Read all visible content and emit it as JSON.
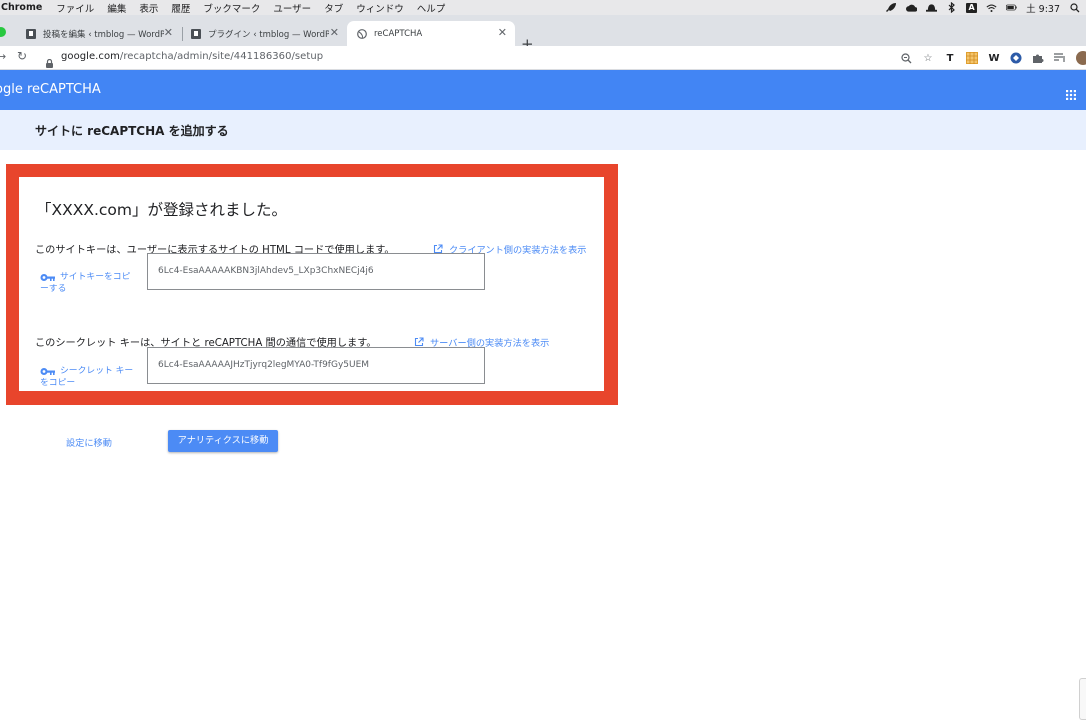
{
  "menubar": {
    "app": "Chrome",
    "items": [
      "ファイル",
      "編集",
      "表示",
      "履歴",
      "ブックマーク",
      "ユーザー",
      "タブ",
      "ウィンドウ",
      "ヘルプ"
    ],
    "input_indicator": "A",
    "clock": "土 9:37"
  },
  "tabs": [
    {
      "title": "投稿を編集 ‹ tmblog — WordPre"
    },
    {
      "title": "プラグイン ‹ tmblog — WordPre"
    },
    {
      "title": "reCAPTCHA"
    }
  ],
  "toolbar": {
    "url_host": "google.com",
    "url_path": "/recaptcha/admin/site/441186360/setup",
    "ext_t": "T",
    "ext_w": "W"
  },
  "header": {
    "logo": "ogle reCAPTCHA"
  },
  "page": {
    "title": "サイトに reCAPTCHA を追加する"
  },
  "card": {
    "registered": "「XXXX.com」が登録されました。",
    "site_key_desc": "このサイトキーは、ユーザーに表示するサイトの HTML コードで使用します。",
    "client_link": "クライアント側の実装方法を表示",
    "copy_site_key_1": "サイトキーをコピ",
    "copy_site_key_2": "ーする",
    "site_key": "6Lc4-EsaAAAAAKBN3jlAhdev5_LXp3ChxNECj4j6",
    "secret_desc": "このシークレット キーは、サイトと reCAPTCHA 間の通信で使用します。",
    "server_link": "サーバー側の実装方法を表示",
    "copy_secret_1": "シークレット キー",
    "copy_secret_2": "をコピー",
    "secret_key": "6Lc4-EsaAAAAAJHzTjyrq2legMYA0-Tf9fGy5UEM"
  },
  "actions": {
    "settings": "設定に移動",
    "analytics": "アナリティクスに移動"
  },
  "colors": {
    "brand_blue": "#4285f4",
    "highlight_red": "#e8452c",
    "link_blue": "#4c8bf5"
  }
}
